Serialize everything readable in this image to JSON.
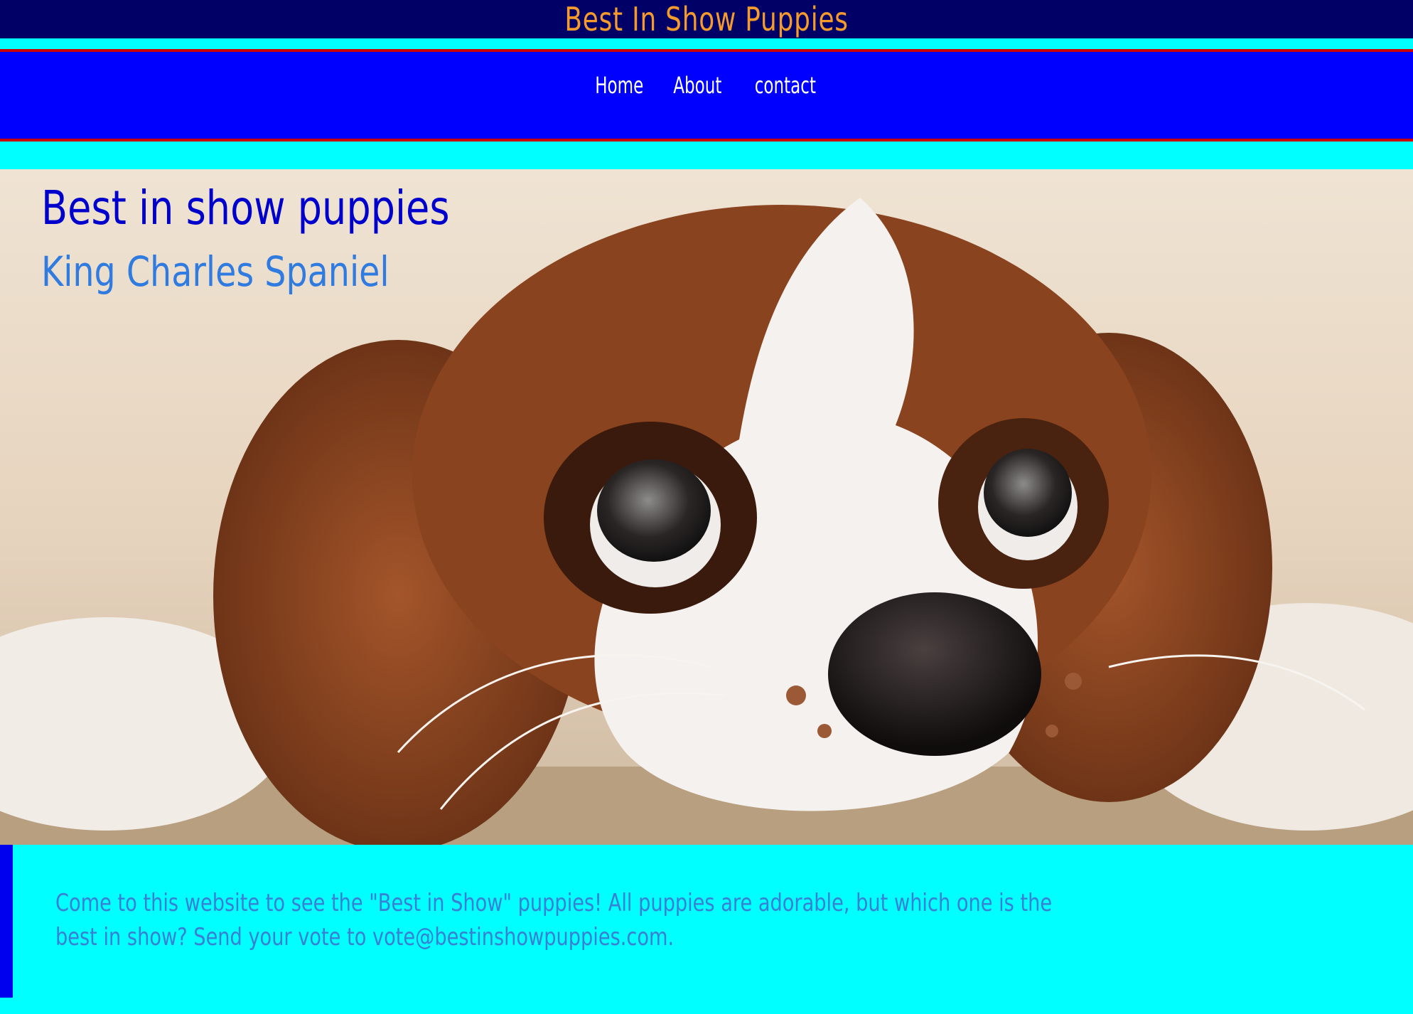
{
  "header": {
    "title": "Best In Show Puppies"
  },
  "nav": {
    "items": [
      {
        "label": "Home"
      },
      {
        "label": "About"
      },
      {
        "label": "contact"
      }
    ]
  },
  "hero": {
    "heading": "Best in show puppies",
    "subheading": "King Charles Spaniel"
  },
  "content": {
    "text": "Come to this website to see the \"Best in Show\" puppies! All puppies are adorable, but which one is the best in show? Send your vote to vote@bestinshowpuppies.com."
  },
  "colors": {
    "page_background": "#00ffff",
    "header_background": "#000066",
    "title_color": "#f59a2c",
    "nav_background": "#0000ff",
    "nav_border": "#cc0000",
    "nav_text": "#ffffff",
    "hero_heading": "#0000cc",
    "hero_subheading": "#2f7be0",
    "body_text": "#3a7fd6",
    "content_accent_bar": "#0000ee"
  }
}
